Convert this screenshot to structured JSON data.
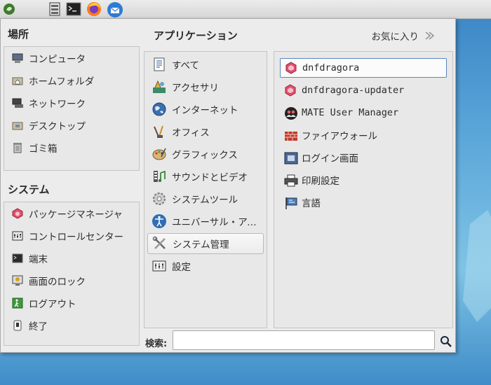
{
  "panel": {
    "launchers": [
      {
        "icon": "mate-menu-icon"
      },
      {
        "icon": "file-manager-icon"
      },
      {
        "icon": "terminal-icon"
      },
      {
        "icon": "firefox-icon"
      },
      {
        "icon": "thunderbird-icon"
      }
    ]
  },
  "places": {
    "heading": "場所",
    "items": [
      {
        "label": "コンピュータ",
        "icon": "computer-icon"
      },
      {
        "label": "ホームフォルダ",
        "icon": "home-folder-icon"
      },
      {
        "label": "ネットワーク",
        "icon": "network-icon"
      },
      {
        "label": "デスクトップ",
        "icon": "desktop-folder-icon"
      },
      {
        "label": "ゴミ箱",
        "icon": "trash-icon"
      }
    ]
  },
  "system": {
    "heading": "システム",
    "items": [
      {
        "label": "パッケージマネージャ",
        "icon": "package-manager-icon"
      },
      {
        "label": "コントロールセンター",
        "icon": "control-center-icon"
      },
      {
        "label": "端末",
        "icon": "terminal-icon"
      },
      {
        "label": "画面のロック",
        "icon": "lock-screen-icon"
      },
      {
        "label": "ログアウト",
        "icon": "logout-icon"
      },
      {
        "label": "終了",
        "icon": "shutdown-icon"
      }
    ]
  },
  "applications": {
    "heading": "アプリケーション",
    "favorites_label": "お気に入り",
    "categories": [
      {
        "label": "すべて",
        "icon": "all-apps-icon"
      },
      {
        "label": "アクセサリ",
        "icon": "accessories-icon"
      },
      {
        "label": "インターネット",
        "icon": "internet-globe-icon"
      },
      {
        "label": "オフィス",
        "icon": "office-icon"
      },
      {
        "label": "グラフィックス",
        "icon": "graphics-palette-icon"
      },
      {
        "label": "サウンドとビデオ",
        "icon": "multimedia-icon"
      },
      {
        "label": "システムツール",
        "icon": "system-tools-gear-icon"
      },
      {
        "label": "ユニバーサル・アク…",
        "icon": "accessibility-icon"
      },
      {
        "label": "システム管理",
        "icon": "administration-tools-icon"
      },
      {
        "label": "設定",
        "icon": "preferences-icon"
      }
    ],
    "selected_category": "システム管理",
    "apps": [
      {
        "label": "dnfdragora",
        "icon": "dnfdragora-icon"
      },
      {
        "label": "dnfdragora-updater",
        "icon": "dnfdragora-updater-icon"
      },
      {
        "label": "MATE User Manager",
        "icon": "user-manager-icon"
      },
      {
        "label": "ファイアウォール",
        "icon": "firewall-icon"
      },
      {
        "label": "ログイン画面",
        "icon": "login-screen-icon"
      },
      {
        "label": "印刷設定",
        "icon": "printer-icon"
      },
      {
        "label": "言語",
        "icon": "language-flag-icon"
      }
    ]
  },
  "search": {
    "label": "検索:",
    "value": "",
    "icon": "search-icon"
  }
}
